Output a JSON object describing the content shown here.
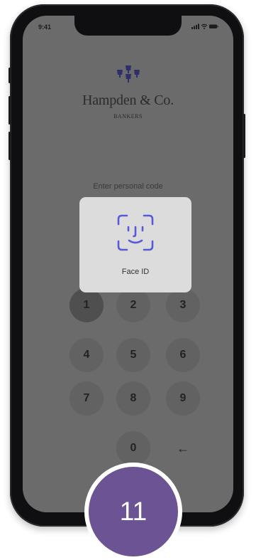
{
  "status_bar": {
    "time": "9:41",
    "icons": [
      "signal-icon",
      "wifi-icon",
      "battery-icon"
    ]
  },
  "brand": {
    "name": "Hampden & Co.",
    "subtitle": "BANKERS",
    "logo_icon": "crest-icon"
  },
  "login": {
    "prompt": "Enter personal code"
  },
  "face_id": {
    "label": "Face ID",
    "icon": "face-id-icon",
    "accent": "#5a5ad8"
  },
  "keypad": {
    "keys": [
      "1",
      "2",
      "3",
      "4",
      "5",
      "6",
      "7",
      "8",
      "9",
      "0"
    ],
    "backspace": "←"
  },
  "step": {
    "number": "11"
  },
  "colors": {
    "badge": "#6b5394",
    "screen_overlay": "#6b6b6b",
    "card": "#dcdcdc"
  }
}
